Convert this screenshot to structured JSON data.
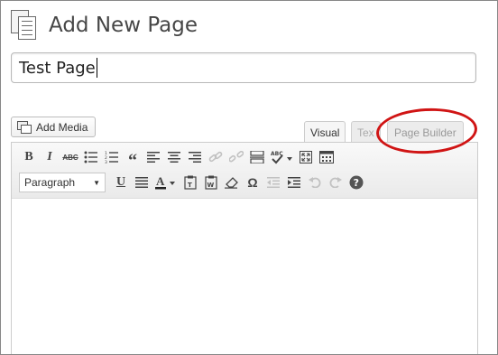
{
  "page": {
    "title": "Add New Page",
    "icon": "pages-icon"
  },
  "post_title": {
    "value": "Test Page"
  },
  "media": {
    "add_media_label": "Add Media",
    "icon": "media-icon"
  },
  "editor_tabs": [
    {
      "label": "Visual",
      "active": true
    },
    {
      "label": "Text",
      "visible_text": "Tex",
      "active": false
    },
    {
      "label": "Page Builder",
      "active": false
    }
  ],
  "toolbar": {
    "row1": [
      {
        "name": "bold",
        "glyph": "B"
      },
      {
        "name": "italic",
        "glyph": "I"
      },
      {
        "name": "strikethrough",
        "glyph": "ABC"
      },
      {
        "name": "bullet-list",
        "icon": "bullet-list-icon"
      },
      {
        "name": "numbered-list",
        "icon": "numbered-list-icon"
      },
      {
        "name": "blockquote",
        "glyph": "“"
      },
      {
        "name": "align-left",
        "icon": "align-left-icon"
      },
      {
        "name": "align-center",
        "icon": "align-center-icon"
      },
      {
        "name": "align-right",
        "icon": "align-right-icon"
      },
      {
        "name": "insert-link",
        "icon": "link-icon",
        "disabled": true
      },
      {
        "name": "remove-link",
        "icon": "unlink-icon",
        "disabled": true
      },
      {
        "name": "insert-more",
        "icon": "read-more-icon"
      },
      {
        "name": "spellcheck",
        "glyph": "ABC"
      },
      {
        "name": "fullscreen",
        "icon": "fullscreen-icon"
      },
      {
        "name": "kitchen-sink",
        "icon": "kitchen-sink-icon"
      }
    ],
    "format_select": "Paragraph",
    "row2": [
      {
        "name": "underline",
        "glyph": "U"
      },
      {
        "name": "justify",
        "icon": "justify-icon"
      },
      {
        "name": "text-color",
        "glyph": "A"
      },
      {
        "name": "paste-text",
        "icon": "paste-text-icon"
      },
      {
        "name": "paste-word",
        "icon": "paste-word-icon"
      },
      {
        "name": "clear-formatting",
        "icon": "eraser-icon"
      },
      {
        "name": "special-character",
        "glyph": "Ω"
      },
      {
        "name": "outdent",
        "icon": "outdent-icon",
        "disabled": true
      },
      {
        "name": "indent",
        "icon": "indent-icon"
      },
      {
        "name": "undo",
        "icon": "undo-icon",
        "disabled": true
      },
      {
        "name": "redo",
        "icon": "redo-icon",
        "disabled": true
      },
      {
        "name": "help",
        "glyph": "?"
      }
    ]
  },
  "highlight": {
    "color": "#d01414",
    "target": "Page Builder"
  }
}
